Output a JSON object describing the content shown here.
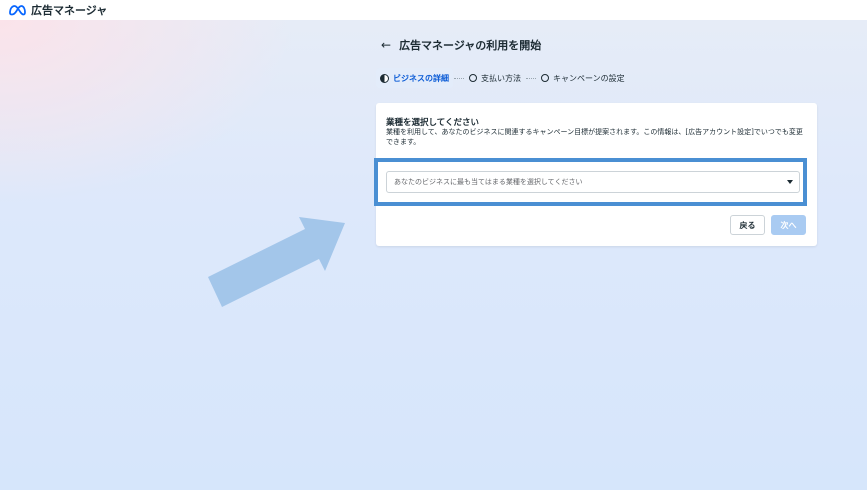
{
  "brand": {
    "name": "広告マネージャ",
    "logo": "meta-logo-icon"
  },
  "header": {
    "back_icon": "←",
    "title": "広告マネージャの利用を開始"
  },
  "steps": [
    {
      "label": "ビジネスの詳細",
      "state": "active"
    },
    {
      "label": "支払い方法",
      "state": "pending"
    },
    {
      "label": "キャンペーンの設定",
      "state": "pending"
    }
  ],
  "card": {
    "title": "業種を選択してください",
    "description": "業種を利用して、あなたのビジネスに関連するキャンペーン目標が提案されます。この情報は、[広告アカウント設定]でいつでも変更できます。",
    "select": {
      "placeholder": "あなたのビジネスに最も当てはまる業種を選択してください",
      "value": ""
    },
    "buttons": {
      "back": "戻る",
      "next": "次へ"
    }
  },
  "colors": {
    "highlight": "#4a8fd3",
    "arrow": "#a3c6ea",
    "active_step": "#0a5bd6",
    "next_disabled": "#a9cbf2"
  }
}
